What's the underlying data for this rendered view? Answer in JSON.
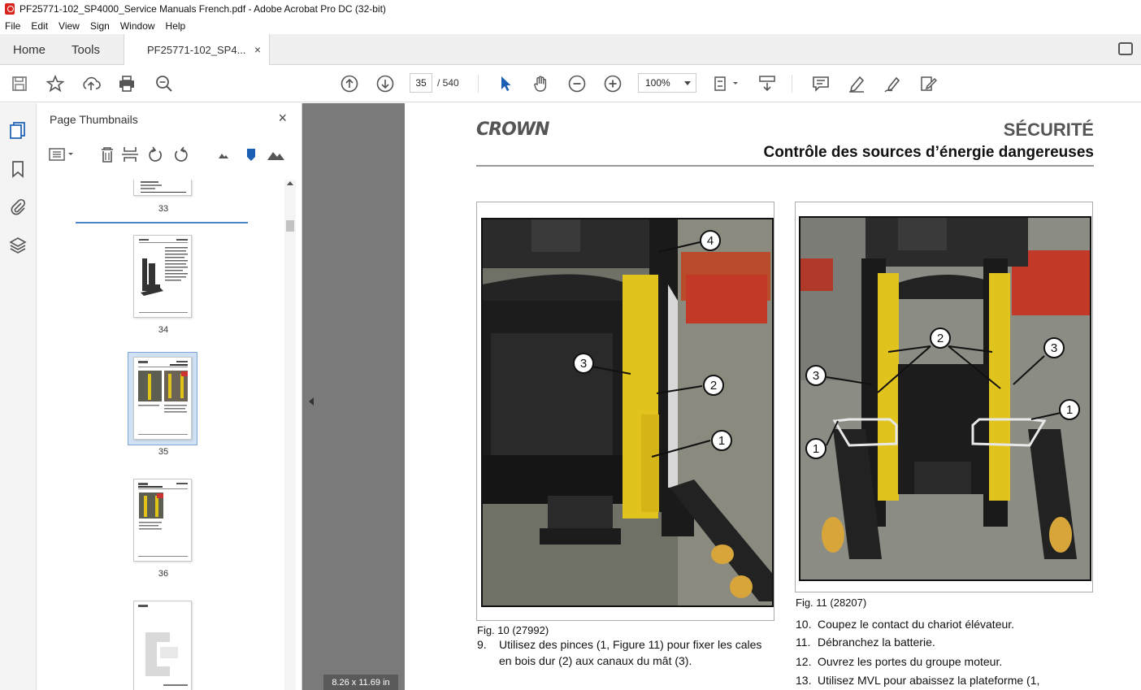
{
  "window": {
    "title": "PF25771-102_SP4000_Service Manuals French.pdf - Adobe Acrobat Pro DC (32-bit)"
  },
  "menu": [
    "File",
    "Edit",
    "View",
    "Sign",
    "Window",
    "Help"
  ],
  "tabs": {
    "home": "Home",
    "tools": "Tools",
    "document": "PF25771-102_SP4...",
    "close": "×"
  },
  "toolbar": {
    "page_current": "35",
    "page_separator": "/ 540",
    "zoom": "100%"
  },
  "thumbnails": {
    "title": "Page Thumbnails",
    "close": "×",
    "pages": [
      "33",
      "34",
      "35",
      "36"
    ],
    "selected": "35"
  },
  "page_size": "8.26 x 11.69 in",
  "document": {
    "logo": "CROWN",
    "section_title": "SÉCURITÉ",
    "section_subtitle": "Contrôle des sources d’énergie dangereuses",
    "fig10_caption": "Fig. 10 (27992)",
    "fig11_caption": "Fig. 11 (28207)",
    "fig10_callouts": [
      "4",
      "3",
      "2",
      "1"
    ],
    "fig11_callouts": [
      "2",
      "3",
      "3",
      "1",
      "1"
    ],
    "step9_num": "9.",
    "step9_text": "Utilisez des pinces (1, Figure 11) pour fixer les cales en bois dur (2) aux canaux du mât (3).",
    "steps": [
      {
        "num": "10.",
        "text": "Coupez le contact du chariot élévateur."
      },
      {
        "num": "11.",
        "text": "Débranchez la batterie."
      },
      {
        "num": "12.",
        "text": "Ouvrez les portes du groupe moteur."
      },
      {
        "num": "13.",
        "text": "Utilisez MVL pour abaissez la plateforme (1,"
      }
    ]
  },
  "colors": {
    "accent": "#4a86c8",
    "selected_bg": "#cfe1f3",
    "gutter": "#7a7a7a",
    "wood": "#e3c218"
  }
}
